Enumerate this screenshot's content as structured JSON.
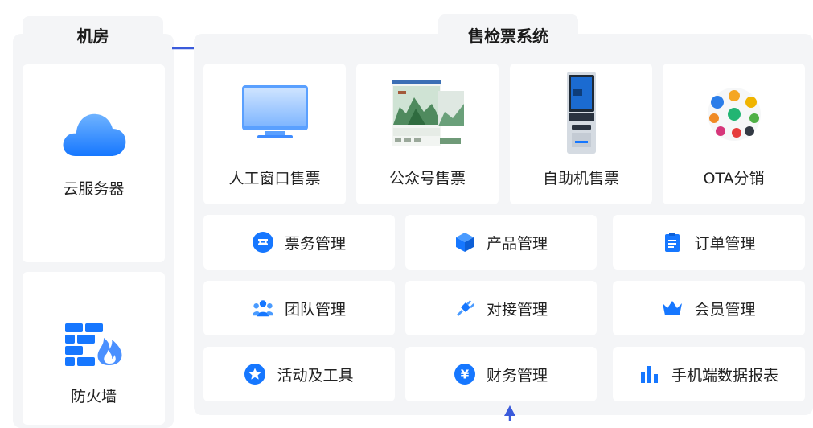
{
  "machine_room": {
    "title": "机房",
    "items": [
      {
        "label": "云服务器",
        "icon": "cloud-icon"
      },
      {
        "label": "防火墙",
        "icon": "firewall-icon"
      }
    ]
  },
  "ticket_system": {
    "title": "售检票系统",
    "channels": [
      {
        "label": "人工窗口售票",
        "icon": "monitor-icon"
      },
      {
        "label": "公众号售票",
        "icon": "wechat-screenshot-image"
      },
      {
        "label": "自助机售票",
        "icon": "kiosk-image"
      },
      {
        "label": "OTA分销",
        "icon": "ota-logos-image"
      }
    ],
    "modules": [
      {
        "label": "票务管理",
        "icon": "ticket-icon"
      },
      {
        "label": "产品管理",
        "icon": "cube-icon"
      },
      {
        "label": "订单管理",
        "icon": "clipboard-icon"
      },
      {
        "label": "团队管理",
        "icon": "team-icon"
      },
      {
        "label": "对接管理",
        "icon": "plug-icon"
      },
      {
        "label": "会员管理",
        "icon": "crown-icon"
      },
      {
        "label": "活动及工具",
        "icon": "star-icon"
      },
      {
        "label": "财务管理",
        "icon": "yen-icon"
      },
      {
        "label": "手机端数据报表",
        "icon": "bar-chart-icon"
      }
    ]
  },
  "colors": {
    "accent": "#1677ff",
    "arrow": "#3b5bdb",
    "panel": "#f4f5f7"
  }
}
